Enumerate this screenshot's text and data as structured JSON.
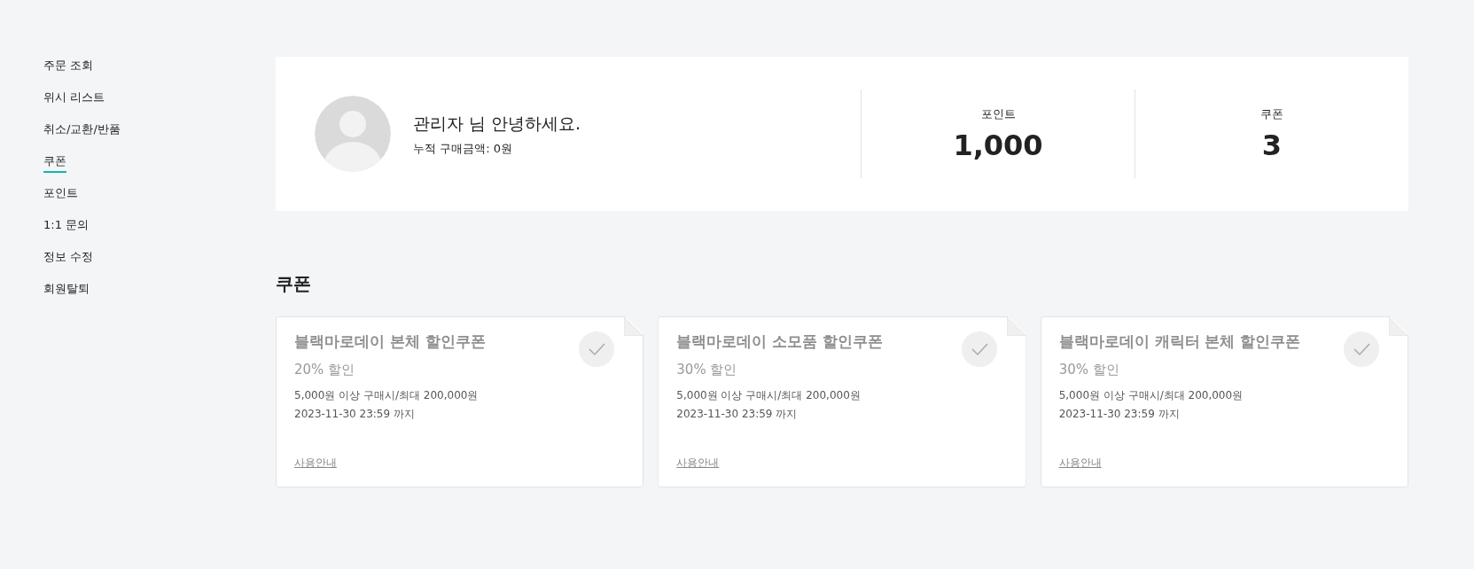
{
  "sidebar": {
    "items": [
      {
        "label": "주문 조회",
        "selected": false
      },
      {
        "label": "위시 리스트",
        "selected": false
      },
      {
        "label": "취소/교환/반품",
        "selected": false
      },
      {
        "label": "쿠폰",
        "selected": true
      },
      {
        "label": "포인트",
        "selected": false
      },
      {
        "label": "1:1 문의",
        "selected": false
      },
      {
        "label": "정보 수정",
        "selected": false
      },
      {
        "label": "회원탈퇴",
        "selected": false
      }
    ]
  },
  "profile": {
    "greeting": "관리자 님 안녕하세요.",
    "total_purchase": "누적 구매금액: 0원"
  },
  "stats": [
    {
      "label": "포인트",
      "value": "1,000"
    },
    {
      "label": "쿠폰",
      "value": "3"
    }
  ],
  "section_title": "쿠폰",
  "coupons": [
    {
      "title": "블랙마로데이 본체 할인쿠폰",
      "discount": "20% 할인",
      "condition": "5,000원 이상 구매시/최대 200,000원",
      "expiry": "2023-11-30 23:59 까지",
      "link": "사용안내"
    },
    {
      "title": "블랙마로데이 소모품 할인쿠폰",
      "discount": "30% 할인",
      "condition": "5,000원 이상 구매시/최대 200,000원",
      "expiry": "2023-11-30 23:59 까지",
      "link": "사용안내"
    },
    {
      "title": "블랙마로데이 캐릭터 본체 할인쿠폰",
      "discount": "30% 할인",
      "condition": "5,000원 이상 구매시/최대 200,000원",
      "expiry": "2023-11-30 23:59 까지",
      "link": "사용안내"
    }
  ]
}
